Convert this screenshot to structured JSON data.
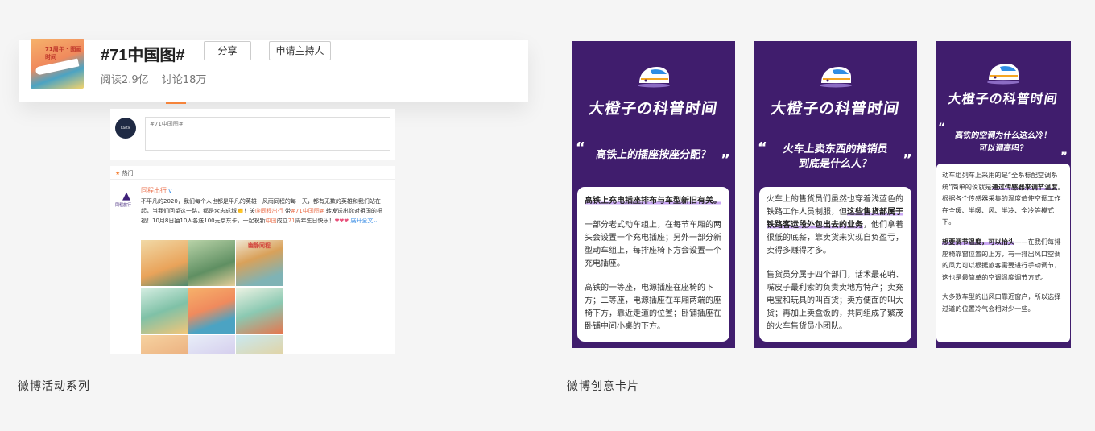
{
  "topic": {
    "title": "#71中国图#",
    "share_label": "分享",
    "host_label": "申请主持人",
    "reads": "阅读2.9亿",
    "discussions": "讨论18万",
    "thumb_text": "71周年 · 图画时间"
  },
  "composer": {
    "avatar_text": "Castle Arkam",
    "placeholder": "#71中国图#"
  },
  "feed": {
    "section_label": "热门",
    "avatar_label": "同程旅行",
    "author": "同程出行",
    "verified_mark": "V",
    "body_part1": "不平凡的2020，我们每个人也都是平凡的英雄！风雨同程的每一天，都有无数的英雄和我们站在一起，当我们回望这一路，都是众志成城",
    "body_part2": "！关",
    "mention": "@同程出行",
    "body_part3": " 带",
    "hashtag": "#71中国图#",
    "body_part4": " 转发送出你对祖国的祝福！10月8日抽10人各送100元京东卡，一起祝新",
    "china": "中国",
    "body_part5": "成立",
    "num71": "71",
    "body_part6": "周年生日快乐！",
    "expand": "展开全文",
    "poster_text": "幽静同程"
  },
  "captions": {
    "left": "微博活动系列",
    "right": "微博创意卡片"
  },
  "cards": [
    {
      "title": "大橙子の科普时间",
      "question": "高铁上的插座按座分配？",
      "quote_open": "“",
      "quote_close": "”",
      "lead": "高铁上充电插座排布与车型新旧有关。",
      "p1": "一部分老式动车组上，在每节车厢的两头会设置一个充电插座；另外一部分新型动车组上，每排座椅下方会设置一个充电插座。",
      "p2": "高铁的一等座，电源插座在座椅的下方；二等座，电源插座在车厢两端的座椅下方，靠近走道的位置；卧铺插座在卧铺中间小桌的下方。"
    },
    {
      "title": "大橙子の科普时间",
      "question": "火车上卖东西的推销员",
      "question2": "到底是什么人？",
      "quote_open": "“",
      "quote_close": "”",
      "p1_a": "火车上的售货员们虽然也穿着浅蓝色的铁路工作人员制服，但",
      "p1_hl": "这些售货部属于铁路客运段外包出去的业务",
      "p1_b": "，他们拿着很低的底薪，靠卖货来实现自负盈亏，卖得多赚得才多。",
      "p2": "售货员分属于四个部门，话术最花哨、嘴皮子最利索的负责卖地方特产；卖充电宝和玩具的叫百货；卖方便面的叫大货；再加上卖盒饭的，共同组成了繁茂的火车售货员小团队。"
    },
    {
      "title": "大橙子の科普时间",
      "question": "高铁的空调为什么这么冷！",
      "question2": "可以调高吗？",
      "quote_open": "“",
      "quote_close": "”",
      "p1_a": "动车组列车上采用的是“全系标配空调系统”简单的说就是",
      "p1_hl": "通过传感器来调节温度",
      "p1_b": "。根据各个传感器采集的温度值使空调工作在全暖、半暖、风、半冷、全冷等模式下。",
      "p2_hl": "想要调节温度，可以抬头",
      "p2_b": "——在我们每排座椅靠窗位置的上方，有一排出风口空调的风力可以根据旅客需要进行手动调节，这也是最简单的空调温度调节方式。",
      "p3": "大多数车型的出风口靠近窗户，所以选择过道的位置冷气会相对少一些。"
    }
  ],
  "colors": {
    "card_bg": "#401d6d",
    "highlight": "#c9a7f3",
    "weibo_orange": "#eb7350",
    "tab_accent": "#f5843b"
  }
}
